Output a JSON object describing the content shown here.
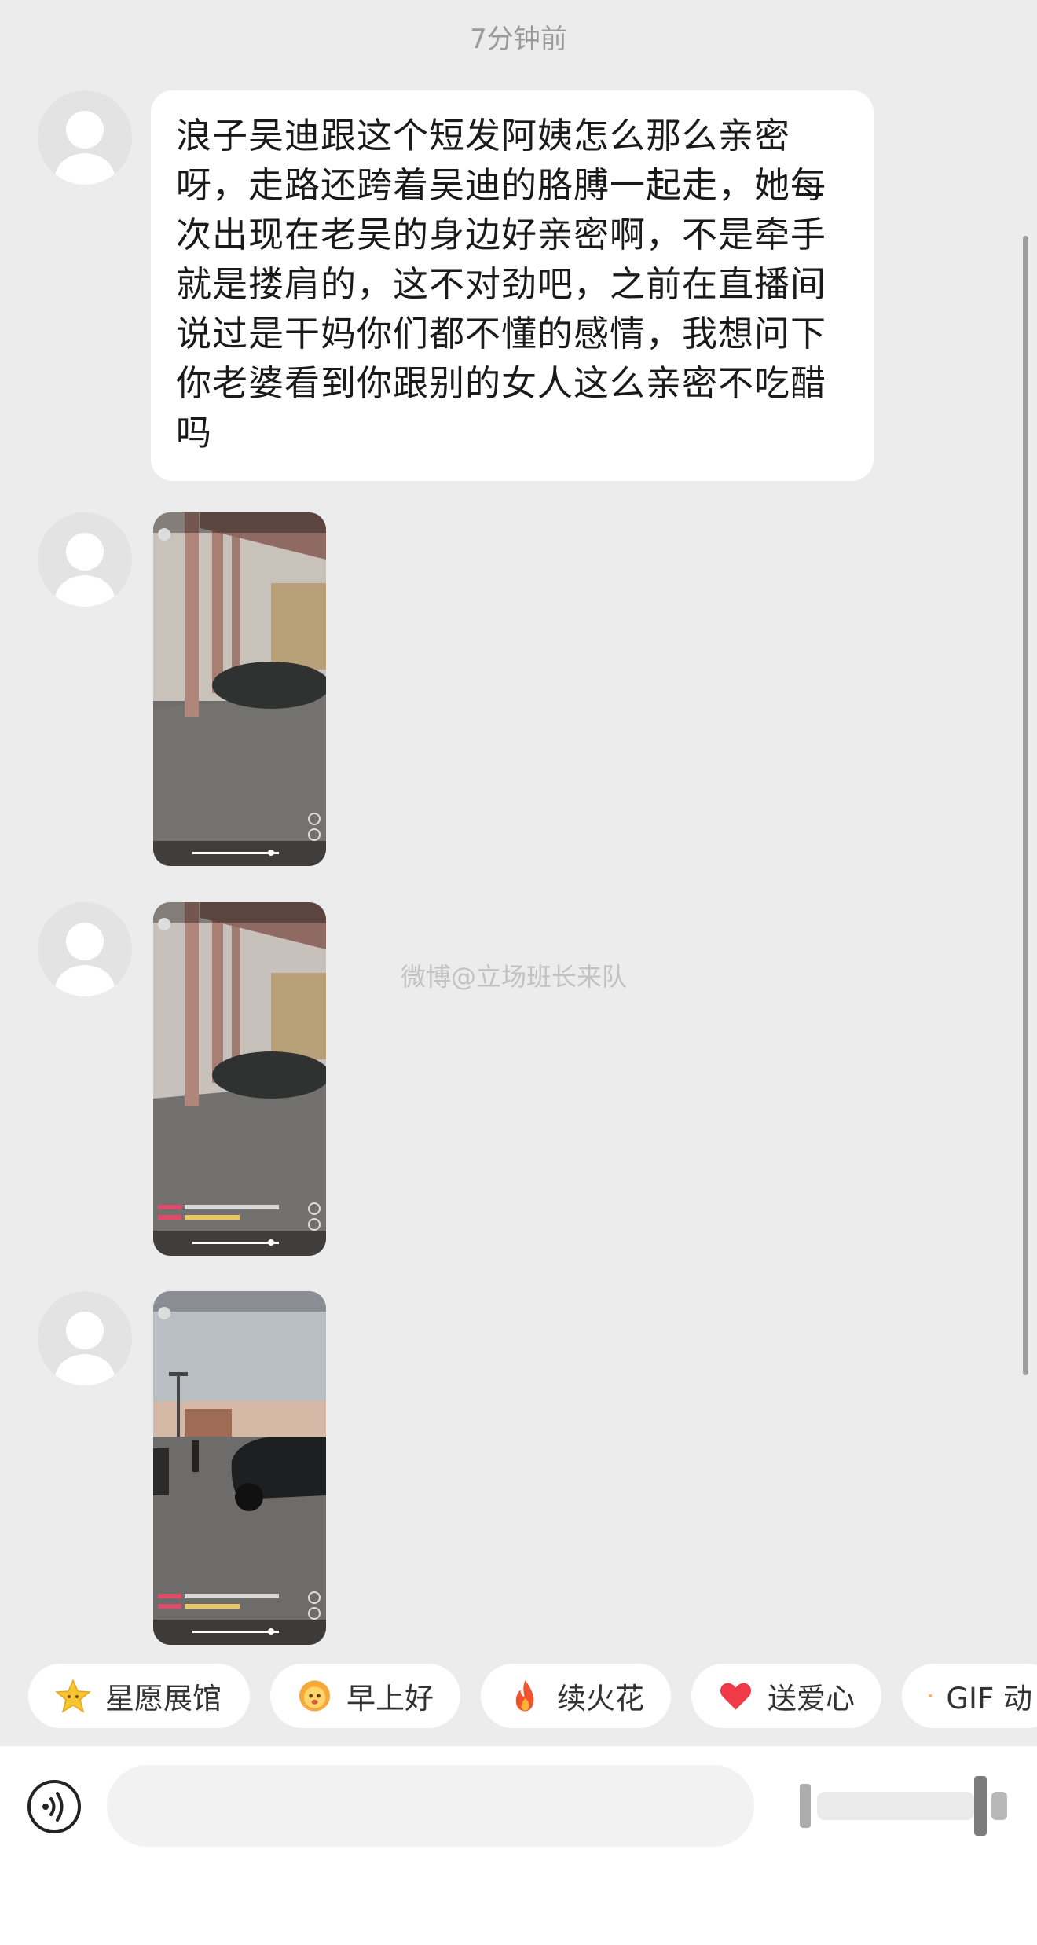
{
  "header": {
    "timestamp": "7分钟前"
  },
  "messages": [
    {
      "type": "text",
      "lines": [
        "浪子吴迪跟这个短发阿姨怎么那么亲密",
        "呀，走路还跨着吴迪的胳膊一起走，她每",
        "次出现在老吴的身边好亲密啊，不是牵手",
        "就是搂肩的，这不对劲吧，之前在直播间",
        "说过是干妈你们都不懂的感情，我想问下",
        "你老婆看到你跟别的女人这么亲密不吃醋",
        "吗"
      ]
    },
    {
      "type": "video",
      "kind": "screen-recording"
    },
    {
      "type": "video",
      "kind": "screen-recording"
    },
    {
      "type": "video",
      "kind": "screen-recording"
    }
  ],
  "watermark": "微博@立场班长来队",
  "quick_chips": [
    {
      "label": "星愿展馆",
      "icon": "star-icon",
      "color": "#f7c531"
    },
    {
      "label": "早上好",
      "icon": "sun-face-icon",
      "color": "#f6a83a"
    },
    {
      "label": "续火花",
      "icon": "fire-icon",
      "color": "#f2532f"
    },
    {
      "label": "送爱心",
      "icon": "heart-icon",
      "color": "#f03a47"
    },
    {
      "label": "GIF 动",
      "icon": "gif-icon",
      "color": "#f39a2b"
    }
  ],
  "input": {
    "placeholder": ""
  },
  "colors": {
    "background": "#ececec",
    "bubble": "#ffffff",
    "text": "#1a1a1a",
    "muted": "#9a9a9a"
  }
}
